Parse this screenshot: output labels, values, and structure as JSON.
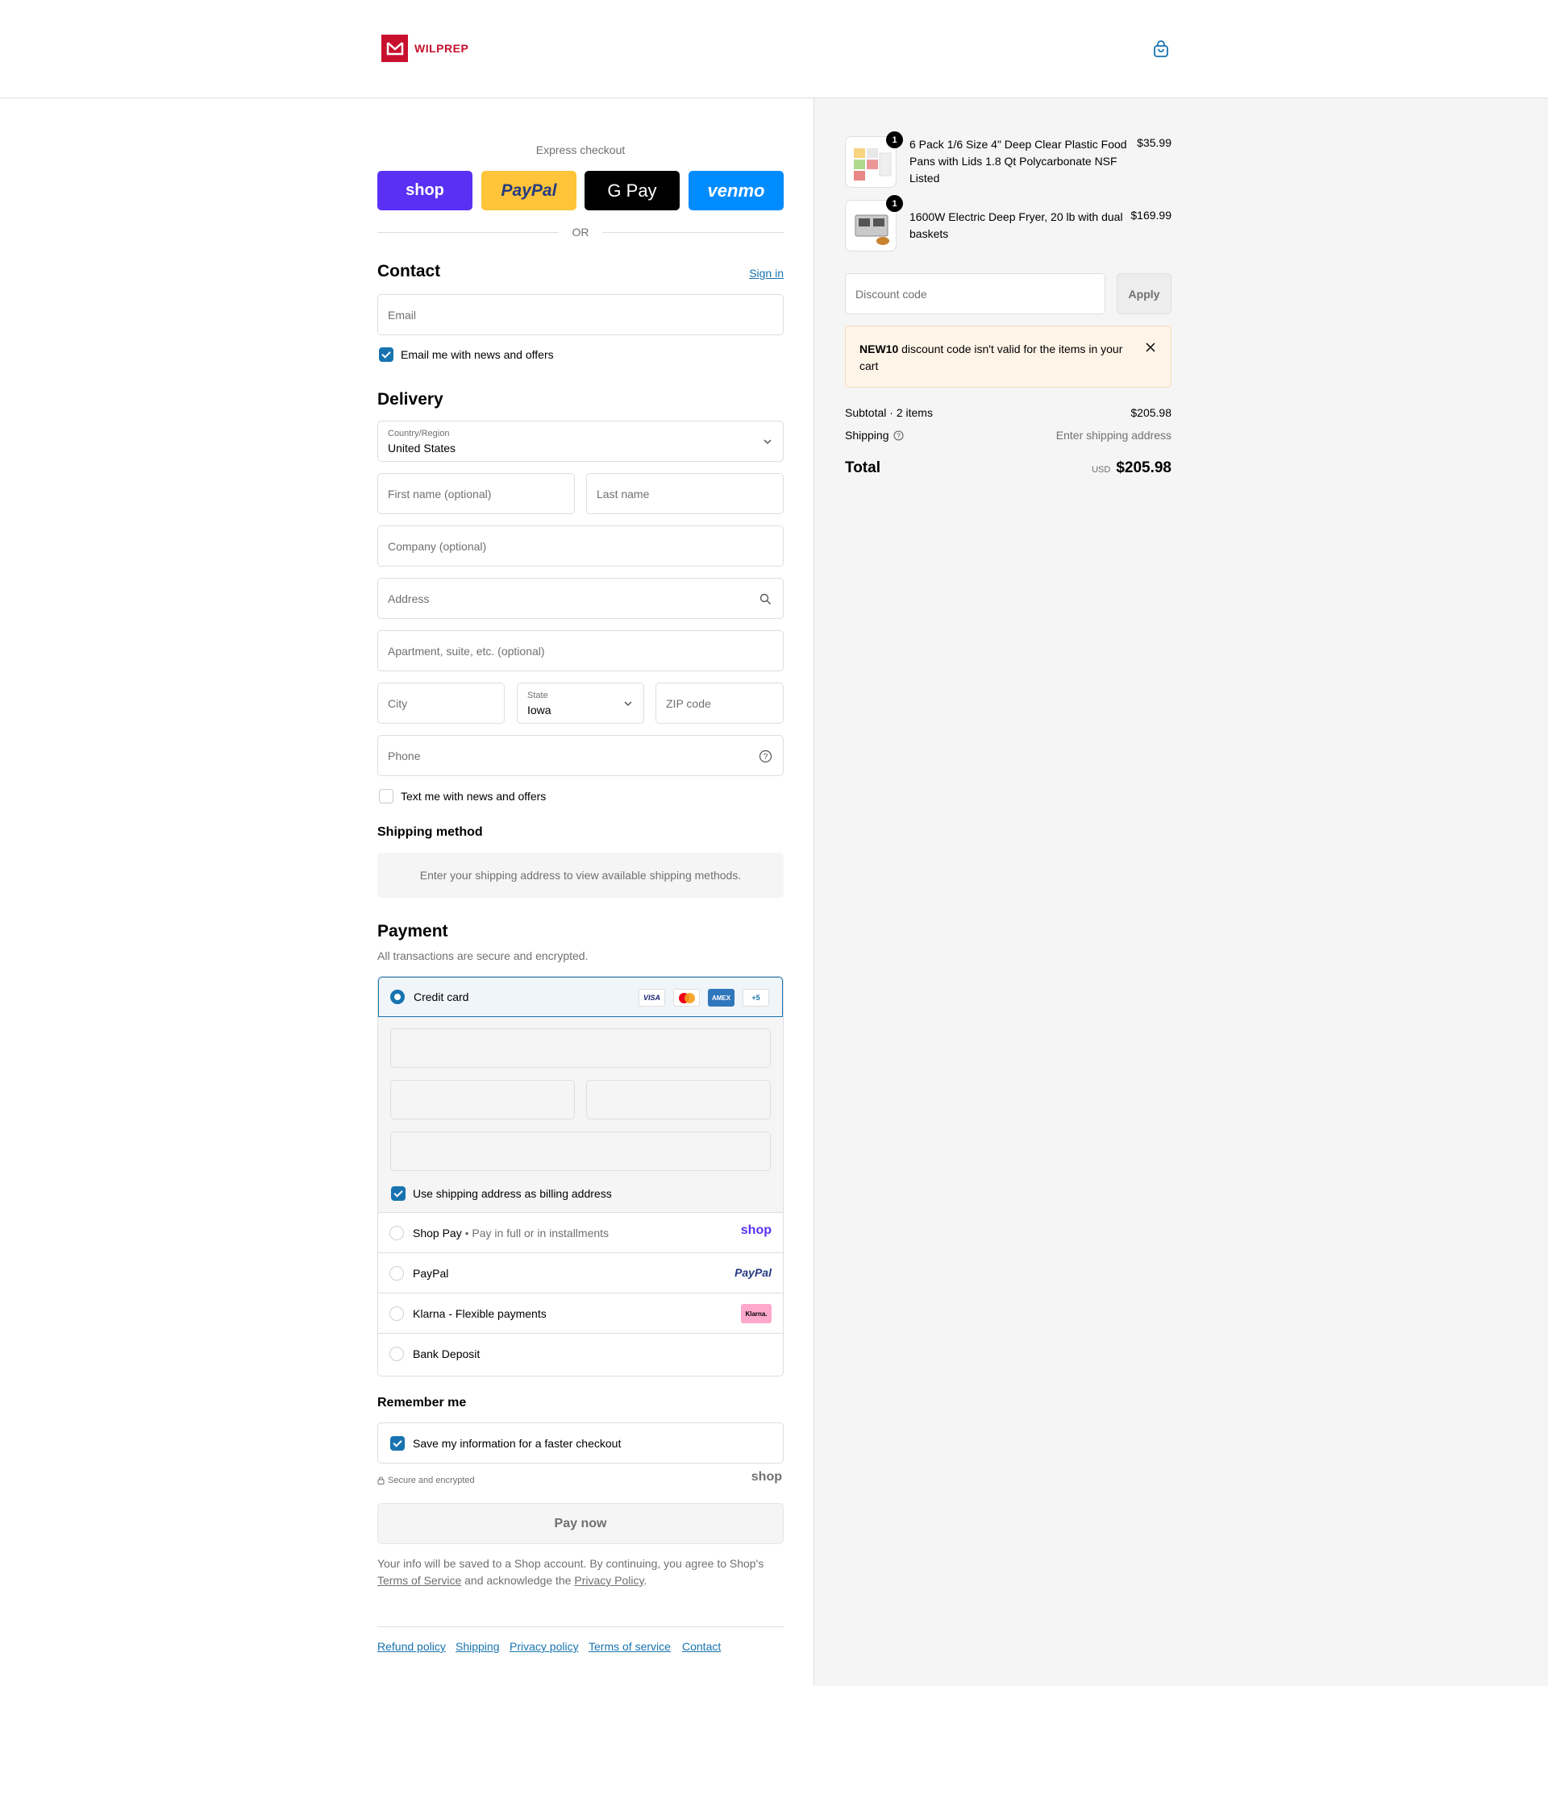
{
  "header": {
    "logo_text": "WILPREP",
    "cart_icon": "shopping-bag-icon"
  },
  "express": {
    "label": "Express checkout",
    "buttons": [
      {
        "label": "shop",
        "color": "#5a31f4"
      },
      {
        "label": "PayPal",
        "color": "#ffc439"
      },
      {
        "label": "G Pay",
        "color": "#000000"
      },
      {
        "label": "venmo",
        "color": "#008cff"
      }
    ],
    "or": "OR"
  },
  "contact": {
    "title": "Contact",
    "sign_in": "Sign in",
    "email_placeholder": "Email",
    "news_label": "Email me with news and offers",
    "news_checked": true
  },
  "delivery": {
    "title": "Delivery",
    "country_label": "Country/Region",
    "country_value": "United States",
    "first_name": "First name (optional)",
    "last_name": "Last name",
    "company": "Company (optional)",
    "address": "Address",
    "apartment": "Apartment, suite, etc. (optional)",
    "city": "City",
    "state_label": "State",
    "state_value": "Iowa",
    "zip": "ZIP code",
    "phone": "Phone",
    "text_label": "Text me with news and offers",
    "text_checked": false
  },
  "shipping_method": {
    "title": "Shipping method",
    "notice": "Enter your shipping address to view available shipping methods."
  },
  "payment": {
    "title": "Payment",
    "subtitle": "All transactions are secure and encrypted.",
    "credit_card": "Credit card",
    "card_logos": [
      "VISA",
      "MC",
      "AMEX",
      "+5"
    ],
    "billing_label": "Use shipping address as billing address",
    "shop_pay": "Shop Pay",
    "shop_pay_sub": "Pay in full or in installments",
    "shop_pay_logo": "shop",
    "paypal": "PayPal",
    "paypal_logo": "PayPal",
    "klarna": "Klarna - Flexible payments",
    "klarna_logo": "Klarna.",
    "bank": "Bank Deposit"
  },
  "remember": {
    "title": "Remember me",
    "save_label": "Save my information for a faster checkout",
    "secure": "Secure and encrypted",
    "shop_logo": "shop"
  },
  "pay_now": "Pay now",
  "legal": {
    "line1": "Your info will be saved to a Shop account. By continuing, you agree to Shop's",
    "terms": "Terms of Service",
    "mid": "and acknowledge the",
    "privacy": "Privacy Policy",
    "end": "."
  },
  "footer_links": [
    "Refund policy",
    "Shipping",
    "Privacy policy",
    "Terms of service",
    "Contact"
  ],
  "summary": {
    "items": [
      {
        "qty": "1",
        "name": "6 Pack 1/6 Size 4\" Deep Clear Plastic Food Pans with Lids 1.8 Qt Polycarbonate NSF Listed",
        "price": "$35.99"
      },
      {
        "qty": "1",
        "name": "1600W Electric Deep Fryer, 20 lb with dual baskets",
        "price": "$169.99"
      }
    ],
    "discount_placeholder": "Discount code",
    "apply": "Apply",
    "error_code": "NEW10",
    "error_text": "discount code isn't valid for the items in your cart",
    "subtotal_label": "Subtotal · 2 items",
    "subtotal_value": "$205.98",
    "shipping_label": "Shipping",
    "shipping_value": "Enter shipping address",
    "total_label": "Total",
    "currency": "USD",
    "total_value": "$205.98"
  }
}
